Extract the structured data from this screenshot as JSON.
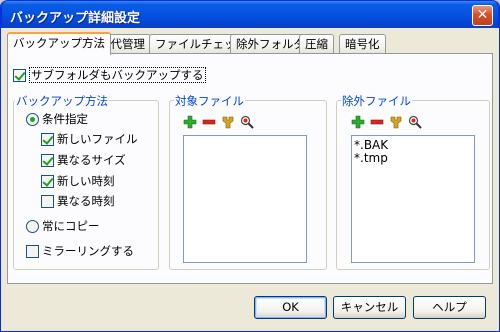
{
  "window": {
    "title": "バックアップ詳細設定",
    "close_label": "✕"
  },
  "tabs": [
    {
      "label": "バックアップ方法",
      "active": true
    },
    {
      "label": "世代管理"
    },
    {
      "label": "ファイルチェック"
    },
    {
      "label": "除外フォルダ"
    },
    {
      "label": "圧縮"
    },
    {
      "label": "暗号化"
    }
  ],
  "subfolders": {
    "label": "サブフォルダもバックアップする",
    "checked": true
  },
  "method": {
    "legend": "バックアップ方法",
    "conditional": {
      "label": "条件指定",
      "selected": true
    },
    "conditions": [
      {
        "label": "新しいファイル",
        "checked": true
      },
      {
        "label": "異なるサイズ",
        "checked": true
      },
      {
        "label": "新しい時刻",
        "checked": true
      },
      {
        "label": "異なる時刻",
        "checked": false
      }
    ],
    "always": {
      "label": "常にコピー",
      "selected": false
    },
    "mirror": {
      "label": "ミラーリングする",
      "checked": false
    }
  },
  "target_files": {
    "legend": "対象ファイル",
    "icons": [
      "add-icon",
      "remove-icon",
      "edit-icon",
      "find-icon"
    ],
    "items": []
  },
  "exclude_files": {
    "legend": "除外ファイル",
    "icons": [
      "add-icon",
      "remove-icon",
      "edit-icon",
      "find-icon"
    ],
    "items": [
      "*.BAK",
      "*.tmp"
    ]
  },
  "buttons": {
    "ok": "OK",
    "cancel": "キャンセル",
    "help": "ヘルプ"
  },
  "colors": {
    "title_bar": "#0554e3",
    "legend_text": "#0046d5",
    "check_green": "#21a121",
    "tab_highlight": "#f1a73d"
  }
}
